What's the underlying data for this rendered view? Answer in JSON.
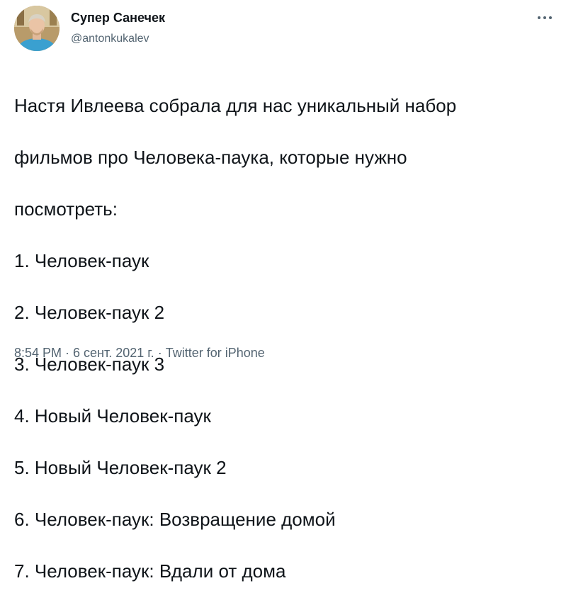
{
  "tweet": {
    "author": {
      "display_name": "Супер Санечек",
      "handle": "@antonkukalev",
      "avatar_icon": "user-avatar-photo"
    },
    "more_icon": "more-dots-icon",
    "text_lines": [
      "Настя Ивлеева собрала для нас уникальный набор",
      "фильмов про Человека-паука, которые нужно",
      "посмотреть:",
      "1. Человек-паук",
      "2. Человек-паук 2",
      "3. Человек-паук 3",
      "4. Новый Человек-паук",
      "5. Новый Человек-паук 2",
      "6. Человек-паук: Возвращение домой",
      "7. Человек-паук: Вдали от дома"
    ],
    "meta": {
      "time": "8:54 PM",
      "separator": "·",
      "date": "6 сент. 2021 г.",
      "source": "Twitter for iPhone"
    }
  },
  "colors": {
    "text": "#0f1419",
    "secondary": "#536471",
    "background": "#ffffff"
  }
}
